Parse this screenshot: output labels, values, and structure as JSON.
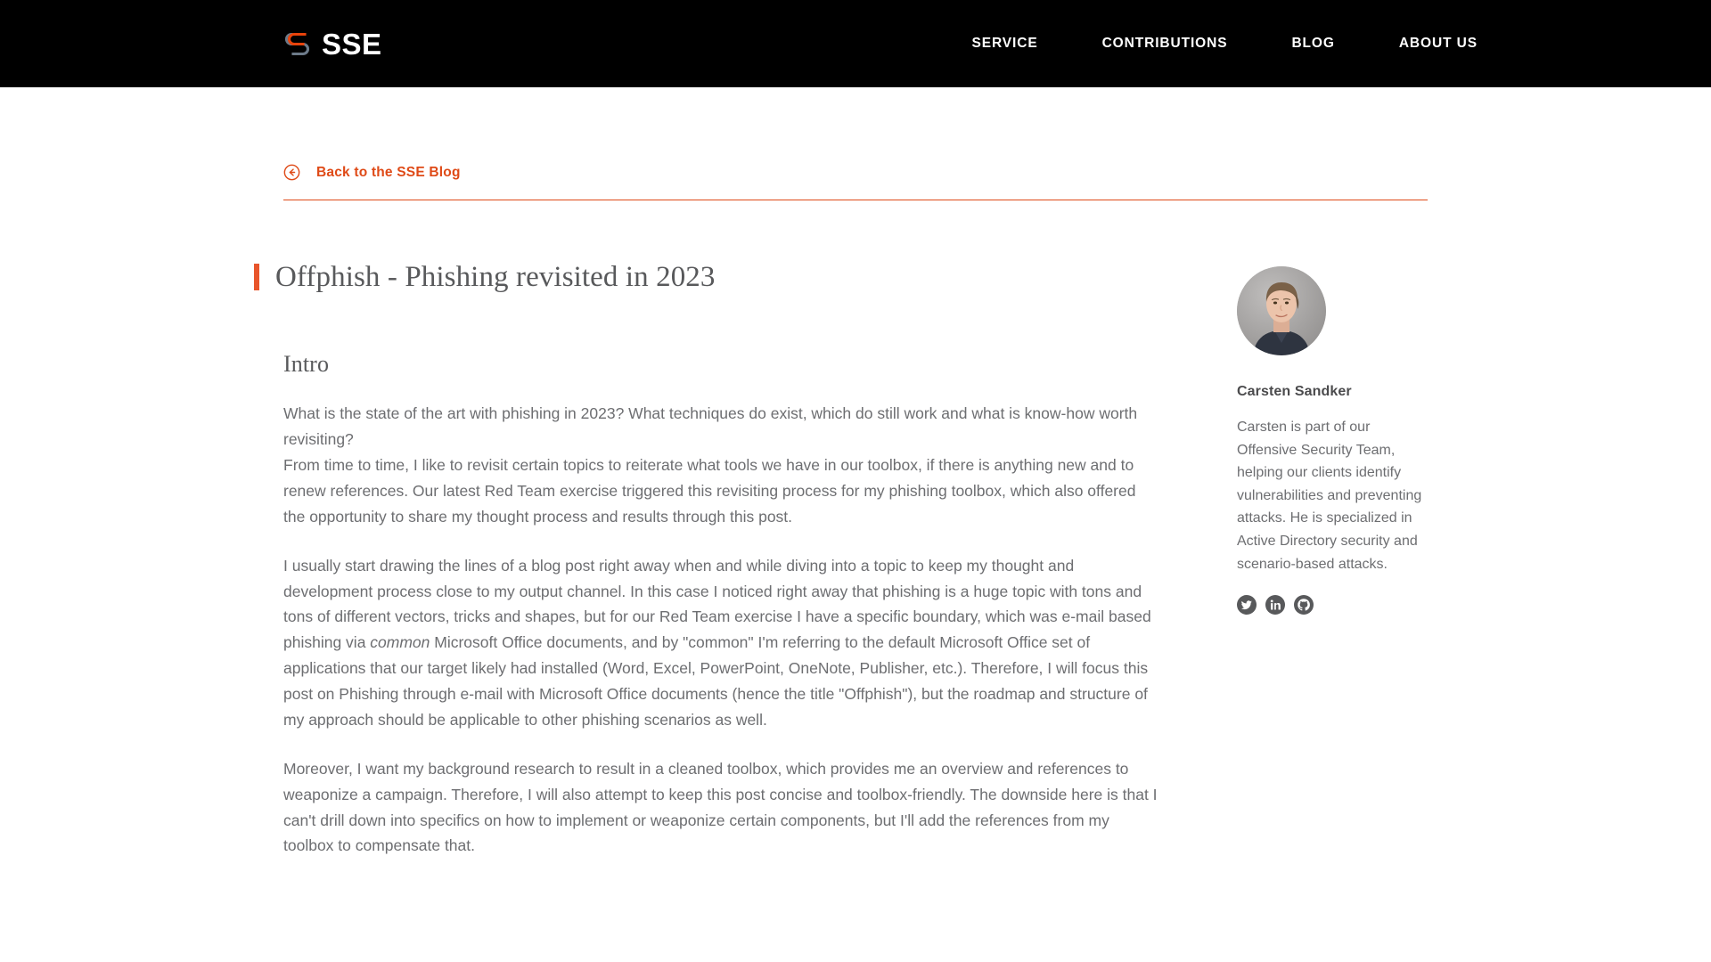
{
  "header": {
    "brand_text": "SSE",
    "brand_icon": "sse-logo-icon",
    "nav": [
      {
        "label": "SERVICE"
      },
      {
        "label": "CONTRIBUTIONS"
      },
      {
        "label": "BLOG"
      },
      {
        "label": "ABOUT US"
      }
    ]
  },
  "back": {
    "label": "Back to the SSE Blog",
    "icon": "arrow-left-circle-icon",
    "color": "#DF4A17"
  },
  "post": {
    "title": "Offphish - Phishing revisited in 2023",
    "accent_color": "#E8552B",
    "section_heading": "Intro",
    "paragraphs": {
      "p1": "What is the state of the art with phishing in 2023? What techniques do exist, which do still work and what is know-how worth revisiting?",
      "p2": "From time to time, I like to revisit certain topics to reiterate what tools we have in our toolbox, if there is anything new and to renew references. Our latest Red Team exercise triggered this revisiting process for my phishing toolbox, which also offered the opportunity to share my thought process and results through this post.",
      "p3_a": "I usually start drawing the lines of a blog post right away when and while diving into a topic to keep my thought and development process close to my output channel. In this case I noticed right away that phishing is a huge topic with tons and tons of different vectors, tricks and shapes, but for our Red Team exercise I have a specific boundary, which was e-mail based phishing via ",
      "p3_em": "common",
      "p3_b": " Microsoft Office documents, and by \"common\" I'm referring to the default Microsoft Office set of applications that our target likely had installed (Word, Excel, PowerPoint, OneNote, Publisher, etc.). Therefore, I will focus this post on Phishing through e-mail with Microsoft Office documents (hence the title \"Offphish\"), but the roadmap and structure of my approach should be applicable to other phishing scenarios as well.",
      "p4": "Moreover, I want my background research to result in a cleaned toolbox, which provides me an overview and references to weaponize a campaign. Therefore, I will also attempt to keep this post concise and toolbox-friendly. The downside here is that I can't drill down into specifics on how to implement or weaponize certain components, but I'll add the references from my toolbox to compensate that."
    }
  },
  "author": {
    "avatar_alt": "author-portrait",
    "name": "Carsten Sandker",
    "bio": "Carsten is part of our Offensive Security Team, helping our clients identify vulnerabilities and preventing attacks. He is specialized in Active Directory security and scenario-based attacks.",
    "socials": [
      {
        "name": "twitter-icon"
      },
      {
        "name": "linkedin-icon"
      },
      {
        "name": "github-icon"
      }
    ]
  }
}
